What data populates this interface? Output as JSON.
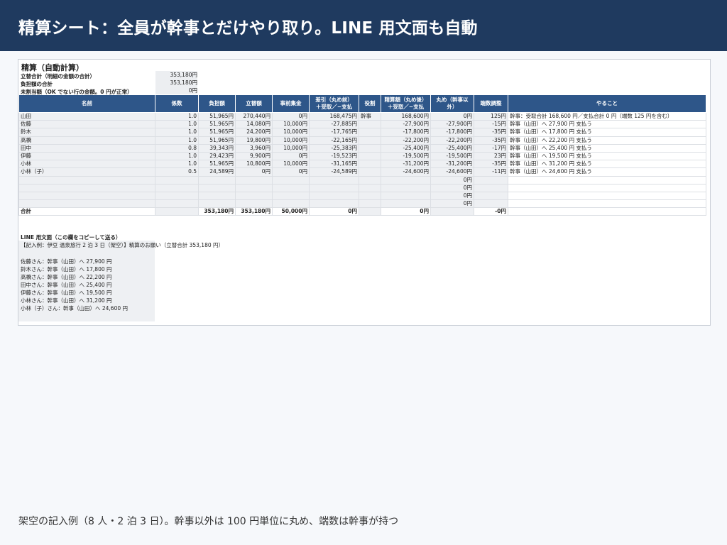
{
  "header": {
    "title": "精算シート：全員が幹事とだけやり取り。LINE 用文面も自動"
  },
  "sheet": {
    "section_title": "精算（自動計算）",
    "summary": [
      {
        "label": "立替合計（明細の金額の合計）",
        "value": "353,180円"
      },
      {
        "label": "負担額の合計",
        "value": "353,180円"
      },
      {
        "label": "未割当額（OK でない行の金額。0 円が正常）",
        "value": "0円"
      }
    ],
    "columns": [
      "名前",
      "係数",
      "負担額",
      "立替額",
      "事前集金",
      "差引（丸め前）\n＋受取／−支払",
      "役割",
      "精算額（丸め後）\n＋受取／−支払",
      "丸め（幹事以外）",
      "端数調整",
      "やること"
    ],
    "rows": [
      [
        "山田",
        "1.0",
        "51,965円",
        "270,440円",
        "0円",
        "168,475円",
        "幹事",
        "168,600円",
        "0円",
        "125円",
        "幹事：受取合計 168,600 円／支払合計 0 円（端数 125 円を含む）"
      ],
      [
        "佐藤",
        "1.0",
        "51,965円",
        "14,080円",
        "10,000円",
        "-27,885円",
        "",
        "-27,900円",
        "-27,900円",
        "-15円",
        "幹事（山田）へ 27,900 円 支払う"
      ],
      [
        "鈴木",
        "1.0",
        "51,965円",
        "24,200円",
        "10,000円",
        "-17,765円",
        "",
        "-17,800円",
        "-17,800円",
        "-35円",
        "幹事（山田）へ 17,800 円 支払う"
      ],
      [
        "高橋",
        "1.0",
        "51,965円",
        "19,800円",
        "10,000円",
        "-22,165円",
        "",
        "-22,200円",
        "-22,200円",
        "-35円",
        "幹事（山田）へ 22,200 円 支払う"
      ],
      [
        "田中",
        "0.8",
        "39,343円",
        "3,960円",
        "10,000円",
        "-25,383円",
        "",
        "-25,400円",
        "-25,400円",
        "-17円",
        "幹事（山田）へ 25,400 円 支払う"
      ],
      [
        "伊藤",
        "1.0",
        "29,423円",
        "9,900円",
        "0円",
        "-19,523円",
        "",
        "-19,500円",
        "-19,500円",
        "23円",
        "幹事（山田）へ 19,500 円 支払う"
      ],
      [
        "小林",
        "1.0",
        "51,965円",
        "10,800円",
        "10,000円",
        "-31,165円",
        "",
        "-31,200円",
        "-31,200円",
        "-35円",
        "幹事（山田）へ 31,200 円 支払う"
      ],
      [
        "小林（子）",
        "0.5",
        "24,589円",
        "0円",
        "0円",
        "-24,589円",
        "",
        "-24,600円",
        "-24,600円",
        "-11円",
        "幹事（山田）へ 24,600 円 支払う"
      ],
      [
        "",
        "",
        "",
        "",
        "",
        "",
        "",
        "",
        "0円",
        "",
        ""
      ],
      [
        "",
        "",
        "",
        "",
        "",
        "",
        "",
        "",
        "0円",
        "",
        ""
      ],
      [
        "",
        "",
        "",
        "",
        "",
        "",
        "",
        "",
        "0円",
        "",
        ""
      ],
      [
        "",
        "",
        "",
        "",
        "",
        "",
        "",
        "",
        "0円",
        "",
        ""
      ]
    ],
    "total": [
      "合計",
      "",
      "353,180円",
      "353,180円",
      "50,000円",
      "0円",
      "",
      "0円",
      "",
      "-0円",
      ""
    ],
    "line": {
      "title": "LINE 用文面（この欄をコピーして送る）",
      "head": "【記入例：伊豆 温泉旅行 2 泊 3 日（架空）】精算のお願い（立替合計 353,180 円）",
      "lines": [
        "佐藤さん：幹事（山田）へ 27,900 円",
        "鈴木さん：幹事（山田）へ 17,800 円",
        "高橋さん：幹事（山田）へ 22,200 円",
        "田中さん：幹事（山田）へ 25,400 円",
        "伊藤さん：幹事（山田）へ 19,500 円",
        "小林さん：幹事（山田）へ 31,200 円",
        "小林（子）さん：幹事（山田）へ 24,600 円"
      ]
    }
  },
  "footer": {
    "caption": "架空の記入例（8 人・2 泊 3 日）。幹事以外は 100 円単位に丸め、端数は幹事が持つ"
  }
}
